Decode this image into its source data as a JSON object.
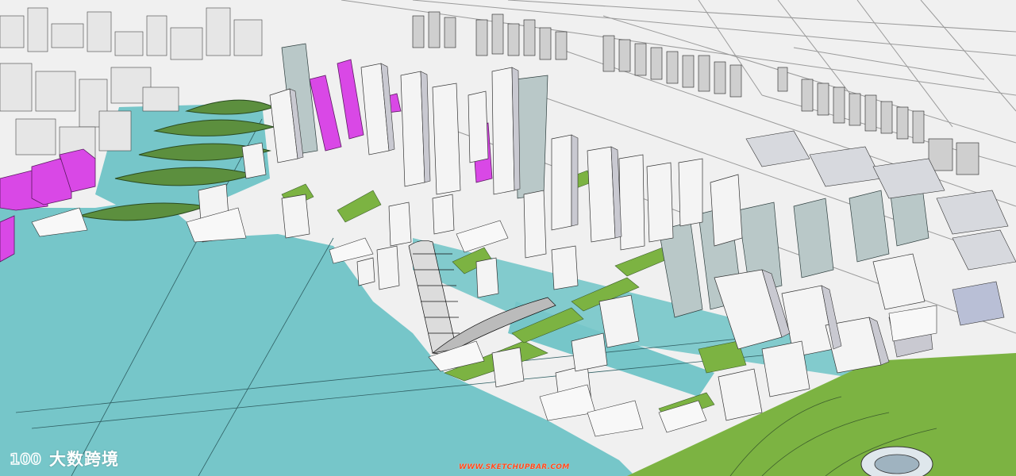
{
  "watermark": {
    "logo_text": "100",
    "brand_text": "大数跨境"
  },
  "site_url": "WWW.SKETCHUPBAR.COM",
  "colors": {
    "water": "#76c6c9",
    "ground": "#f0f0f0",
    "park_green": "#7cb342",
    "dark_green": "#4f7d3a",
    "building_white": "#f4f4f4",
    "building_shade": "#c9c9d1",
    "highlight_magenta": "#d948e6",
    "glass_tower": "#b9c8c8",
    "watermark_orange": "#ff4a1c"
  }
}
